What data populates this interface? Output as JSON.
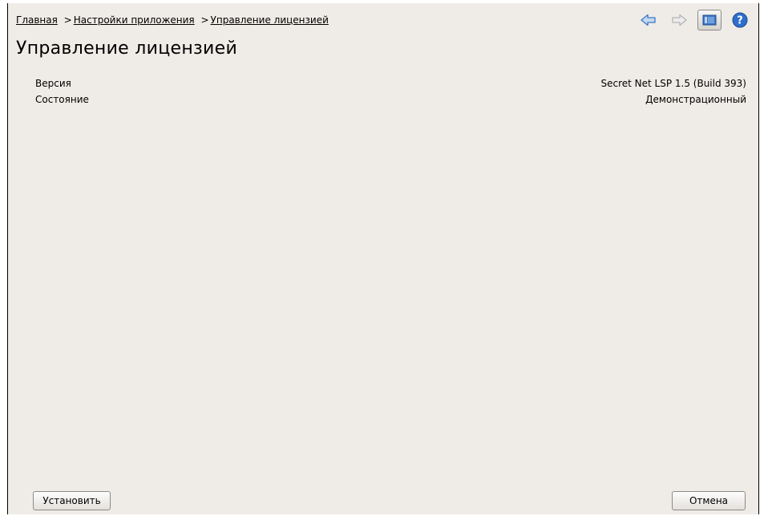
{
  "breadcrumb": {
    "items": [
      "Главная",
      "Настройки приложения",
      "Управление лицензией"
    ],
    "separator": ">"
  },
  "toolbar": {
    "icons": [
      "back-arrow-icon",
      "forward-arrow-icon",
      "panel-toggle-icon",
      "help-icon"
    ],
    "accent_color": "#3e79c5"
  },
  "page": {
    "title": "Управление лицензией"
  },
  "info": {
    "rows": [
      {
        "label": "Версия",
        "value": "Secret Net LSP 1.5 (Build 393)"
      },
      {
        "label": "Состояние",
        "value": "Демонстрационный"
      }
    ]
  },
  "buttons": {
    "install_label": "Установить",
    "cancel_label": "Отмена"
  }
}
